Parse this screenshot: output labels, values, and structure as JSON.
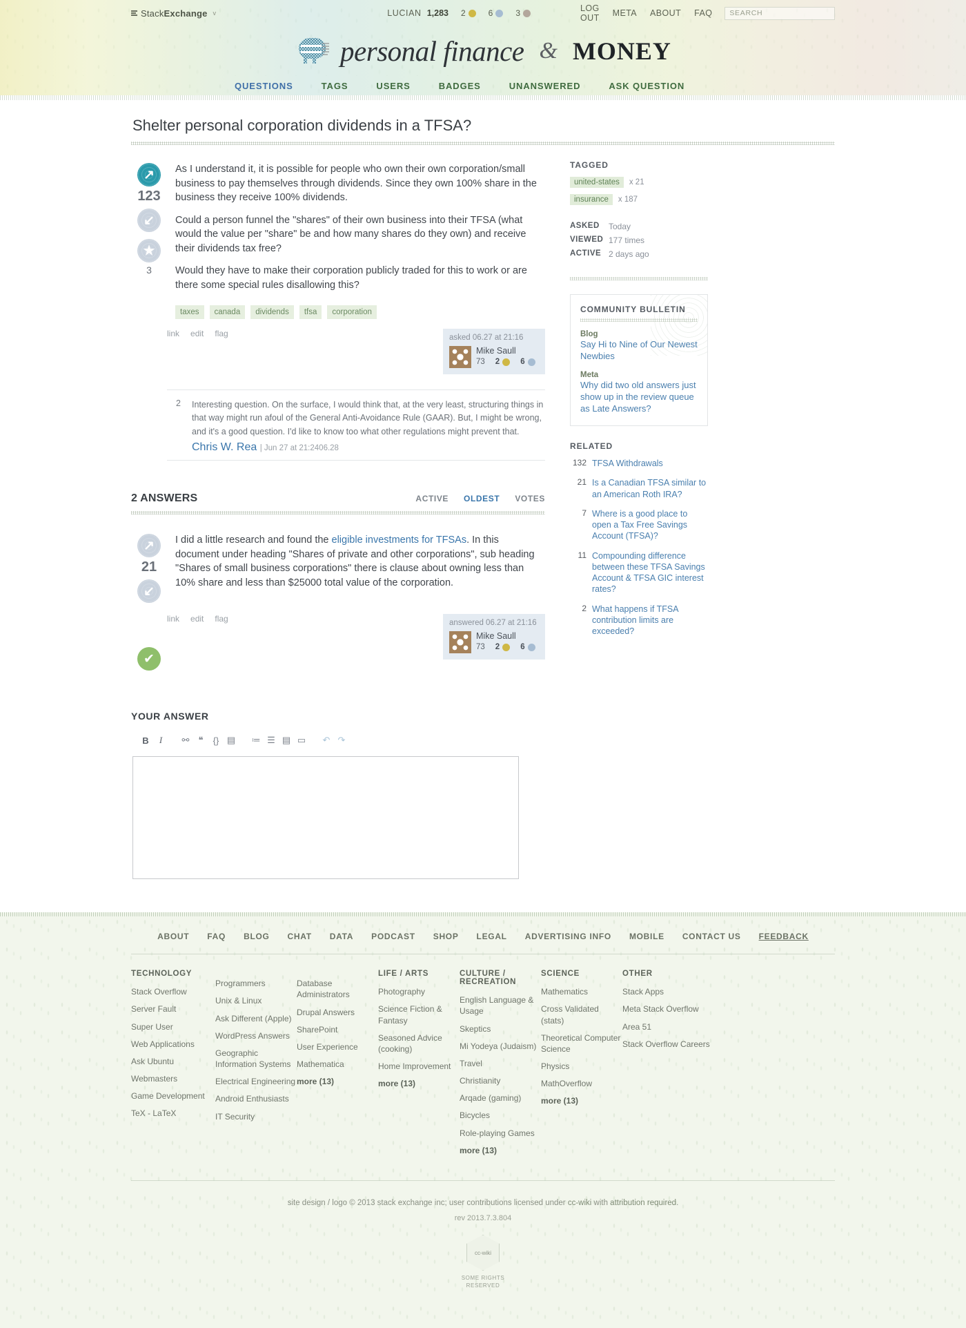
{
  "topbar": {
    "network_label_a": "Stack",
    "network_label_b": "Exchange",
    "caret": "v",
    "username": "LUCIAN",
    "reputation": "1,283",
    "badges": {
      "gold": "2",
      "silver": "6",
      "bronze": "3"
    },
    "links": [
      "LOG OUT",
      "META",
      "ABOUT",
      "FAQ"
    ],
    "search_placeholder": "SEARCH"
  },
  "masthead": {
    "script_text": "personal finance",
    "ampersand": "&",
    "money_text": "MONEY"
  },
  "nav": {
    "items": [
      {
        "label": "QUESTIONS",
        "active": true
      },
      {
        "label": "TAGS",
        "active": false
      },
      {
        "label": "USERS",
        "active": false
      },
      {
        "label": "BADGES",
        "active": false
      },
      {
        "label": "UNANSWERED",
        "active": false
      },
      {
        "label": "ASK QUESTION",
        "active": false
      }
    ]
  },
  "question": {
    "title": "Shelter personal corporation dividends in a TFSA?",
    "votes": "123",
    "favorites": "3",
    "paragraphs": [
      "As I understand it, it is possible for people who own their own corporation/small business to pay themselves through dividends. Since they own 100% share in the business they receive 100% dividends.",
      "Could a person funnel the \"shares\" of their own business into their TFSA (what would the value per \"share\" be and how many shares do they own) and receive their dividends tax free?",
      "Would they have to make their corporation publicly traded for this to work or are there some special rules disallowing this?"
    ],
    "tags": [
      "taxes",
      "canada",
      "dividends",
      "tfsa",
      "corporation"
    ],
    "actions": [
      "link",
      "edit",
      "flag"
    ],
    "owner": {
      "when": "asked 06.27 at 21:16",
      "name": "Mike Saull",
      "rep": "73",
      "gold": "2",
      "silver": "6"
    }
  },
  "comments": [
    {
      "score": "2",
      "text": "Interesting question. On the surface, I would think that, at the very least, structuring things in that way might run afoul of the General Anti-Avoidance Rule (GAAR). But, I might be wrong, and it's a good question. I'd like to know too what other regulations might prevent that.",
      "author": "Chris W. Rea",
      "meta": "| Jun 27 at 21:2406.28"
    }
  ],
  "answers_section": {
    "heading": "2 ANSWERS",
    "sort_tabs": [
      {
        "label": "ACTIVE",
        "active": false
      },
      {
        "label": "OLDEST",
        "active": true
      },
      {
        "label": "VOTES",
        "active": false
      }
    ]
  },
  "answer": {
    "votes": "21",
    "text_before_link": "I did a little research and found the ",
    "link_text": "eligible investments for TFSAs",
    "text_after_link": ". In this document under heading \"Shares of private and other corporations\", sub heading \"Shares of small business corporations\" there is clause about owning less than 10% share and less than $25000 total value of the corporation.",
    "actions": [
      "link",
      "edit",
      "flag"
    ],
    "owner": {
      "when": "answered 06.27 at 21:16",
      "name": "Mike Saull",
      "rep": "73",
      "gold": "2",
      "silver": "6"
    }
  },
  "your_answer": {
    "heading": "YOUR ANSWER",
    "toolbar_icons": [
      "bold-icon",
      "italic-icon",
      "link-icon",
      "blockquote-icon",
      "code-icon",
      "image-icon",
      "numbered-list-icon",
      "bulleted-list-icon",
      "heading-icon",
      "horizontal-rule-icon",
      "undo-icon",
      "redo-icon"
    ],
    "editor_value": "",
    "editor_placeholder": ""
  },
  "sidebar": {
    "tagged_heading": "TAGGED",
    "tagged": [
      {
        "name": "united-states",
        "count": "x 21"
      },
      {
        "name": "insurance",
        "count": "x 187"
      }
    ],
    "stats": [
      {
        "key": "ASKED",
        "value": "Today"
      },
      {
        "key": "VIEWED",
        "value": "177 times"
      },
      {
        "key": "ACTIVE",
        "value": "2 days ago"
      }
    ],
    "bulletin_heading": "COMMUNITY BULLETIN",
    "bulletin_items": [
      {
        "kind": "Blog",
        "title": "Say Hi to Nine of Our Newest Newbies"
      },
      {
        "kind": "Meta",
        "title": "Why did two old answers just show up in the review queue as Late Answers?"
      }
    ],
    "related_heading": "RELATED",
    "related": [
      {
        "score": "132",
        "title": "TFSA Withdrawals"
      },
      {
        "score": "21",
        "title": "Is a Canadian TFSA similar to an American Roth IRA?"
      },
      {
        "score": "7",
        "title": "Where is a good place to open a Tax Free Savings Account (TFSA)?"
      },
      {
        "score": "11",
        "title": "Compounding difference between these TFSA Savings Account & TFSA GIC interest rates?"
      },
      {
        "score": "2",
        "title": "What happens if TFSA contribution limits are exceeded?"
      }
    ]
  },
  "footer": {
    "nav": [
      "ABOUT",
      "FAQ",
      "BLOG",
      "CHAT",
      "DATA",
      "PODCAST",
      "SHOP",
      "LEGAL",
      "ADVERTISING INFO",
      "MOBILE",
      "CONTACT US",
      "FEEDBACK"
    ],
    "columns": [
      {
        "heading": "TECHNOLOGY",
        "items": [
          "Stack Overflow",
          "Server Fault",
          "Super User",
          "Web Applications",
          "Ask Ubuntu",
          "Webmasters",
          "Game Development",
          "TeX - LaTeX"
        ],
        "more": ""
      },
      {
        "heading": "",
        "items": [
          "Programmers",
          "Unix & Linux",
          "Ask Different (Apple)",
          "WordPress Answers",
          "Geographic Information Systems",
          "Electrical Engineering",
          "Android Enthusiasts",
          "IT Security"
        ],
        "more": ""
      },
      {
        "heading": "",
        "items": [
          "Database Administrators",
          "Drupal Answers",
          "SharePoint",
          "User Experience",
          "Mathematica"
        ],
        "more": "more (13)"
      },
      {
        "heading": "LIFE / ARTS",
        "items": [
          "Photography",
          "Science Fiction & Fantasy",
          "Seasoned Advice (cooking)",
          "Home Improvement"
        ],
        "more": "more (13)"
      },
      {
        "heading": "CULTURE / RECREATION",
        "items": [
          "English Language & Usage",
          "Skeptics",
          "Mi Yodeya (Judaism)",
          "Travel",
          "Christianity",
          "Arqade (gaming)",
          "Bicycles",
          "Role-playing Games"
        ],
        "more": "more (13)"
      },
      {
        "heading": "SCIENCE",
        "items": [
          "Mathematics",
          "Cross Validated (stats)",
          "Theoretical Computer Science",
          "Physics",
          "MathOverflow"
        ],
        "more": "more (13)"
      },
      {
        "heading": "OTHER",
        "items": [
          "Stack Apps",
          "Meta Stack Overflow",
          "Area 51",
          "Stack Overflow Careers"
        ],
        "more": ""
      }
    ],
    "legal_pre": "site design / logo © 2013 stack exchange inc; user contributions licensed under ",
    "legal_link1": "cc-wiki",
    "legal_mid": " with ",
    "legal_link2": "attribution required",
    "legal_post": ".",
    "rev": "rev 2013.7.3.804",
    "cc_text": "cc-wiki",
    "cc_caption": "SOME RIGHTS RESERVED"
  },
  "colors": {
    "accent_blue": "#3a76ab",
    "nav_green": "#3f6b3f",
    "upvote_teal": "#2a9aab",
    "accepted_green": "#8fbf6b",
    "tag_bg": "#e6efdf",
    "usercard_bg": "#e4ebf2"
  }
}
